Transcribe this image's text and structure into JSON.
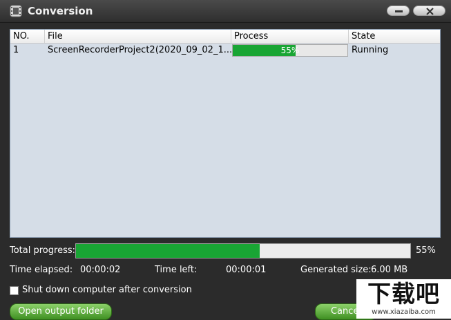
{
  "window": {
    "title": "Conversion",
    "icon": "film-strip-icon",
    "minimize_icon": "minimize-icon",
    "close_icon": "close-icon"
  },
  "table": {
    "headers": {
      "no": "NO.",
      "file": "File",
      "process": "Process",
      "state": "State"
    },
    "rows": [
      {
        "no": "1",
        "file": "ScreenRecorderProject2(2020_09_02_1...",
        "progress": 0.55,
        "progress_text": "55%",
        "state": "Running"
      }
    ]
  },
  "total": {
    "label": "Total progress:",
    "progress": 0.55,
    "percent_text": "55%"
  },
  "info": {
    "elapsed_label": "Time elapsed:",
    "elapsed_value": "00:00:02",
    "left_label": "Time left:",
    "left_value": "00:00:01",
    "size_label": "Generated size:",
    "size_value": "6.00 MB"
  },
  "options": {
    "shutdown_label": "Shut down computer after conversion",
    "shutdown_checked": false
  },
  "buttons": {
    "open_folder": "Open output folder",
    "cancel": "Cancel"
  },
  "watermark": {
    "big": "下载吧",
    "small": "www.xiazaiba.com"
  },
  "colors": {
    "progress_fill": "#19a534",
    "list_background": "#d5dde7",
    "window_background": "#2b2b2b",
    "button_green": "#5aab38"
  }
}
